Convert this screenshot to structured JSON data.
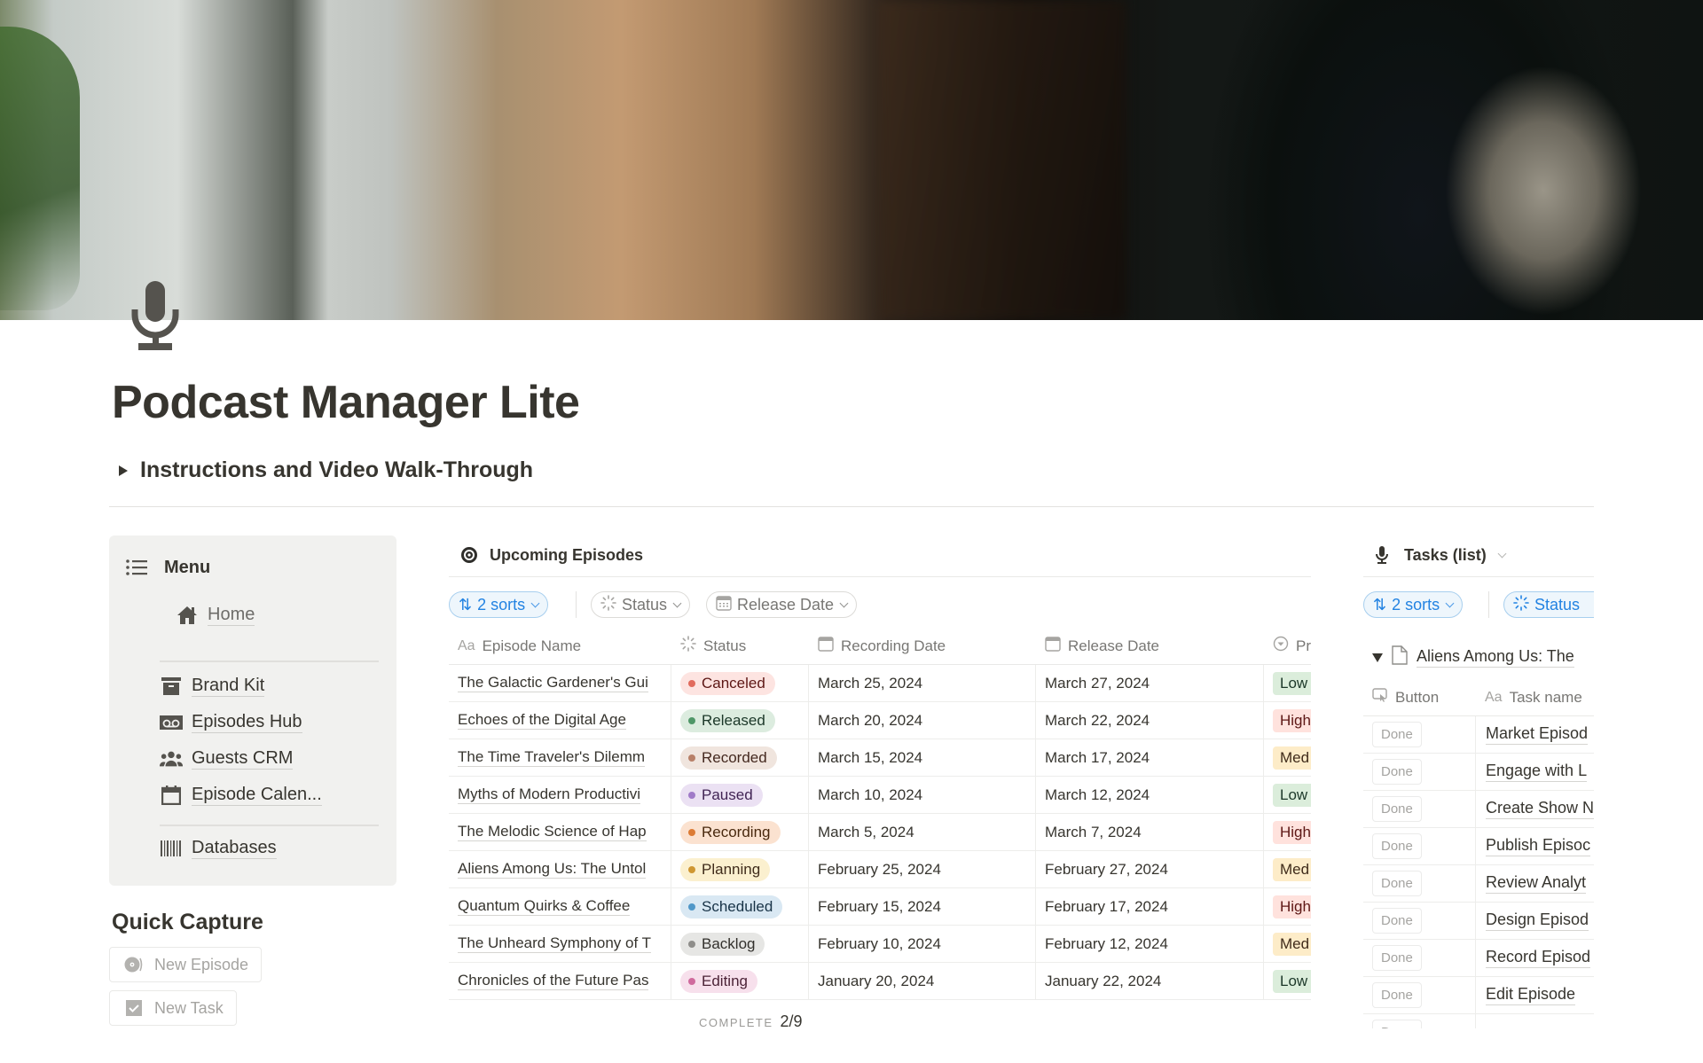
{
  "page": {
    "title": "Podcast Manager Lite",
    "icon": "microphone-icon",
    "toggle_label": "Instructions and Video Walk-Through"
  },
  "menu": {
    "title": "Menu",
    "icon": "list-icon",
    "home": {
      "label": "Home",
      "icon": "home-icon"
    },
    "items": [
      {
        "label": "Brand Kit",
        "icon": "archive-box-icon"
      },
      {
        "label": "Episodes Hub",
        "icon": "voicemail-icon"
      },
      {
        "label": "Guests CRM",
        "icon": "people-icon"
      },
      {
        "label": "Episode Calen...",
        "icon": "calendar-icon"
      }
    ],
    "databases": {
      "label": "Databases",
      "icon": "barcode-icon"
    }
  },
  "quick_capture": {
    "title": "Quick Capture",
    "buttons": [
      {
        "label": "New Episode",
        "icon": "vinyl-record-icon"
      },
      {
        "label": "New Task",
        "icon": "checkbox-icon"
      }
    ]
  },
  "upcoming": {
    "title": "Upcoming Episodes",
    "icon": "target-icon",
    "filters": {
      "sorts": "2 sorts",
      "status": "Status",
      "release_date": "Release Date"
    },
    "columns": {
      "name": "Episode Name",
      "status": "Status",
      "recording": "Recording Date",
      "release": "Release Date",
      "priority": "Pr"
    },
    "rows": [
      {
        "name": "The Galactic Gardener's Gui",
        "status": "Canceled",
        "recording": "March 25, 2024",
        "release": "March 27, 2024",
        "priority": "Low"
      },
      {
        "name": "Echoes of the Digital Age",
        "status": "Released",
        "recording": "March 20, 2024",
        "release": "March 22, 2024",
        "priority": "High"
      },
      {
        "name": "The Time Traveler's Dilemm",
        "status": "Recorded",
        "recording": "March 15, 2024",
        "release": "March 17, 2024",
        "priority": "Med"
      },
      {
        "name": "Myths of Modern Productivi",
        "status": "Paused",
        "recording": "March 10, 2024",
        "release": "March 12, 2024",
        "priority": "Low"
      },
      {
        "name": "The Melodic Science of Hap",
        "status": "Recording",
        "recording": "March 5, 2024",
        "release": "March 7, 2024",
        "priority": "High"
      },
      {
        "name": "Aliens Among Us: The Untol",
        "status": "Planning",
        "recording": "February 25, 2024",
        "release": "February 27, 2024",
        "priority": "Med"
      },
      {
        "name": "Quantum Quirks & Coffee",
        "status": "Scheduled",
        "recording": "February 15, 2024",
        "release": "February 17, 2024",
        "priority": "High"
      },
      {
        "name": "The Unheard Symphony of T",
        "status": "Backlog",
        "recording": "February 10, 2024",
        "release": "February 12, 2024",
        "priority": "Med"
      },
      {
        "name": "Chronicles of the Future Pas",
        "status": "Editing",
        "recording": "January 20, 2024",
        "release": "January 22, 2024",
        "priority": "Low"
      }
    ],
    "footer": {
      "label": "COMPLETE",
      "value": "2/9"
    }
  },
  "status_colors": {
    "Canceled": {
      "bg": "#fde4e1",
      "dot": "#e16b5d",
      "fg": "#5d1715"
    },
    "Released": {
      "bg": "#dcecdf",
      "dot": "#4f9768",
      "fg": "#1c3829"
    },
    "Recorded": {
      "bg": "#f0e5de",
      "dot": "#b88068",
      "fg": "#44291f"
    },
    "Paused": {
      "bg": "#ebe1f3",
      "dot": "#a07ac8",
      "fg": "#412454"
    },
    "Recording": {
      "bg": "#fbe2d0",
      "dot": "#dc7b34",
      "fg": "#49290e"
    },
    "Planning": {
      "bg": "#fbf0cf",
      "dot": "#cf9732",
      "fg": "#402c1b"
    },
    "Scheduled": {
      "bg": "#d9e8f3",
      "dot": "#5097c8",
      "fg": "#183347"
    },
    "Backlog": {
      "bg": "#e6e6e4",
      "dot": "#8e8d8a",
      "fg": "#32302c"
    },
    "Editing": {
      "bg": "#f7e0ec",
      "dot": "#cf6a9d",
      "fg": "#4c2337"
    }
  },
  "priority_colors": {
    "Low": {
      "bg": "#dbeddb",
      "fg": "#1c3829"
    },
    "High": {
      "bg": "#ffe2dd",
      "fg": "#5d1715"
    },
    "Med": {
      "bg": "#fdecc8",
      "fg": "#402c1b"
    }
  },
  "tasks": {
    "title": "Tasks (list)",
    "icon": "microphone-icon",
    "filters": {
      "sorts": "2 sorts",
      "status": "Status"
    },
    "group": "Aliens Among Us: The",
    "columns": {
      "button": "Button",
      "task": "Task name"
    },
    "rows": [
      {
        "button": "Done",
        "task": "Market Episod"
      },
      {
        "button": "Done",
        "task": "Engage with L"
      },
      {
        "button": "Done",
        "task": "Create Show N"
      },
      {
        "button": "Done",
        "task": "Publish Episoc"
      },
      {
        "button": "Done",
        "task": "Review Analyt"
      },
      {
        "button": "Done",
        "task": "Design Episod"
      },
      {
        "button": "Done",
        "task": "Record Episod"
      },
      {
        "button": "Done",
        "task": "Edit Episode"
      },
      {
        "button": "Done",
        "task": ""
      }
    ]
  }
}
